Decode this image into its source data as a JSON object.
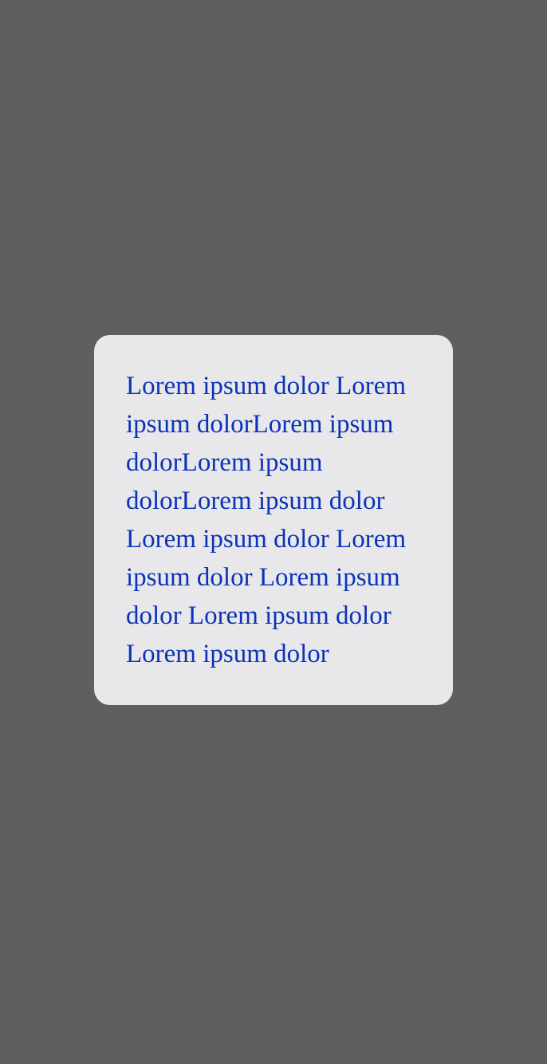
{
  "colors": {
    "overlay_background": "#5f5f5f",
    "card_background": "#e8e7ea",
    "text": "#0a33b8"
  },
  "modal": {
    "lines": [
      "Lorem ipsum dolor Lorem",
      "ipsum dolorLorem ipsum",
      "dolorLorem ipsum",
      "dolorLorem ipsum dolor",
      "Lorem ipsum dolor Lorem",
      "ipsum dolor Lorem ipsum",
      "dolor Lorem ipsum dolor",
      "Lorem ipsum dolor"
    ]
  }
}
